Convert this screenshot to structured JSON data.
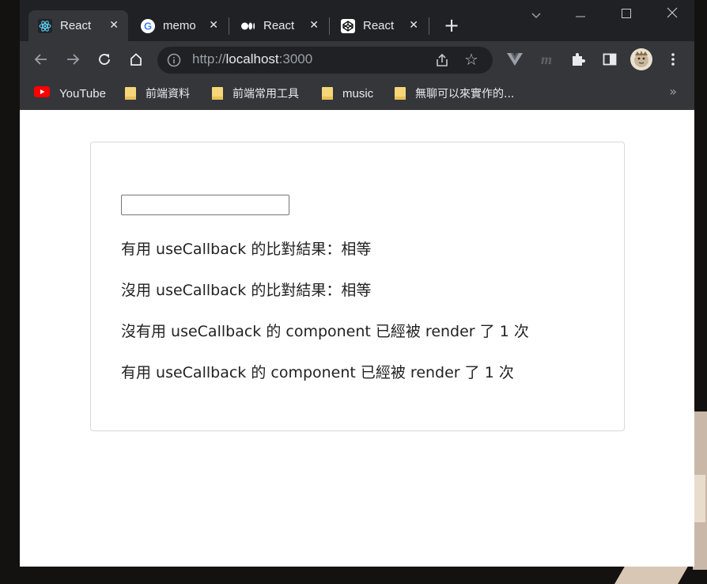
{
  "browser": {
    "tabs": [
      {
        "label": "React",
        "icon": "react-icon",
        "active": true
      },
      {
        "label": "memo",
        "icon": "google-icon",
        "active": false
      },
      {
        "label": "React",
        "icon": "medium-icon",
        "active": false
      },
      {
        "label": "React",
        "icon": "codepen-icon",
        "active": false
      }
    ],
    "new_tab": "+",
    "url_scheme": "http://",
    "url_host": "localhost",
    "url_port": ":3000",
    "bookmarks": [
      {
        "label": "YouTube",
        "icon": "youtube-icon"
      },
      {
        "label": "前端資料",
        "icon": "folder-icon"
      },
      {
        "label": "前端常用工具",
        "icon": "folder-icon"
      },
      {
        "label": "music",
        "icon": "folder-icon"
      },
      {
        "label": "無聊可以來實作的...",
        "icon": "folder-icon"
      }
    ],
    "bookmarks_more": "»"
  },
  "app": {
    "input_value": "",
    "lines": [
      "有用 useCallback 的比對結果：相等",
      "沒用 useCallback 的比對結果：相等",
      "沒有用 useCallback 的 component 已經被 render 了 1 次",
      "有用 useCallback 的 component 已經被 render 了 1 次"
    ]
  },
  "colors": {
    "frame": "#202124",
    "toolbar": "#35363a",
    "page": "#ffffff",
    "text": "#222222"
  }
}
